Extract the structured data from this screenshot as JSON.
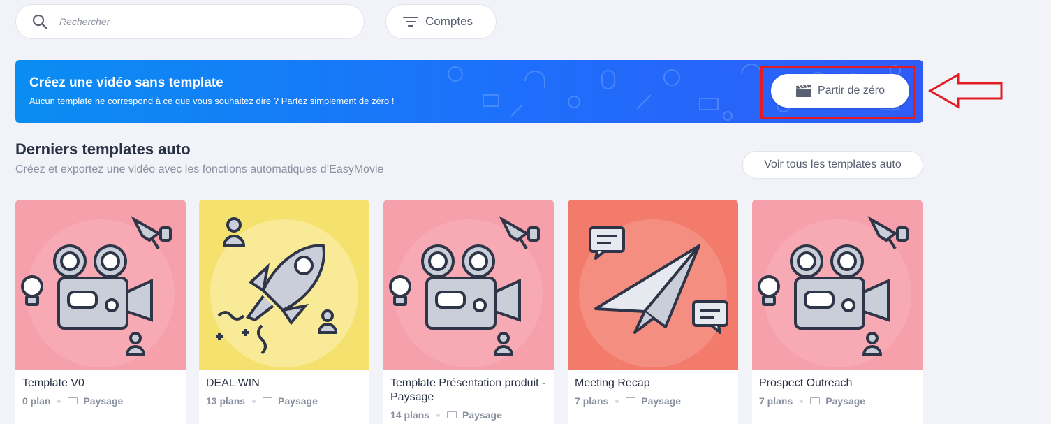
{
  "search": {
    "placeholder": "Rechercher"
  },
  "filter": {
    "label": "Comptes"
  },
  "banner": {
    "title": "Créez une vidéo sans template",
    "subtitle": "Aucun template ne correspond à ce que vous souhaitez dire ? Partez simplement de zéro !",
    "button_label": "Partir de zéro"
  },
  "section": {
    "title": "Derniers templates auto",
    "subtitle": "Créez et exportez une vidéo avec les fonctions automatiques d’EasyMovie",
    "see_all_label": "Voir tous les templates auto"
  },
  "cards": [
    {
      "name": "Template V0",
      "plans": "0 plan",
      "format": "Paysage",
      "bg": "#f6a0ac",
      "circle": "#f8aab4",
      "illustration": "camera-icon"
    },
    {
      "name": "DEAL WIN",
      "plans": "13 plans",
      "format": "Paysage",
      "bg": "#f5e26e",
      "circle": "#f8ea96",
      "illustration": "rocket-icon"
    },
    {
      "name": "Template Présentation produit - Paysage",
      "plans": "14 plans",
      "format": "Paysage",
      "bg": "#f6a0ac",
      "circle": "#f8aab4",
      "illustration": "camera-icon"
    },
    {
      "name": "Meeting Recap",
      "plans": "7 plans",
      "format": "Paysage",
      "bg": "#f27b6c",
      "circle": "#f48e80",
      "illustration": "paper-plane-icon"
    },
    {
      "name": "Prospect Outreach",
      "plans": "7 plans",
      "format": "Paysage",
      "bg": "#f6a0ac",
      "circle": "#f8aab4",
      "illustration": "camera-icon"
    }
  ],
  "colors": {
    "accent": "#1e6ffb",
    "highlight": "#e31b23"
  }
}
